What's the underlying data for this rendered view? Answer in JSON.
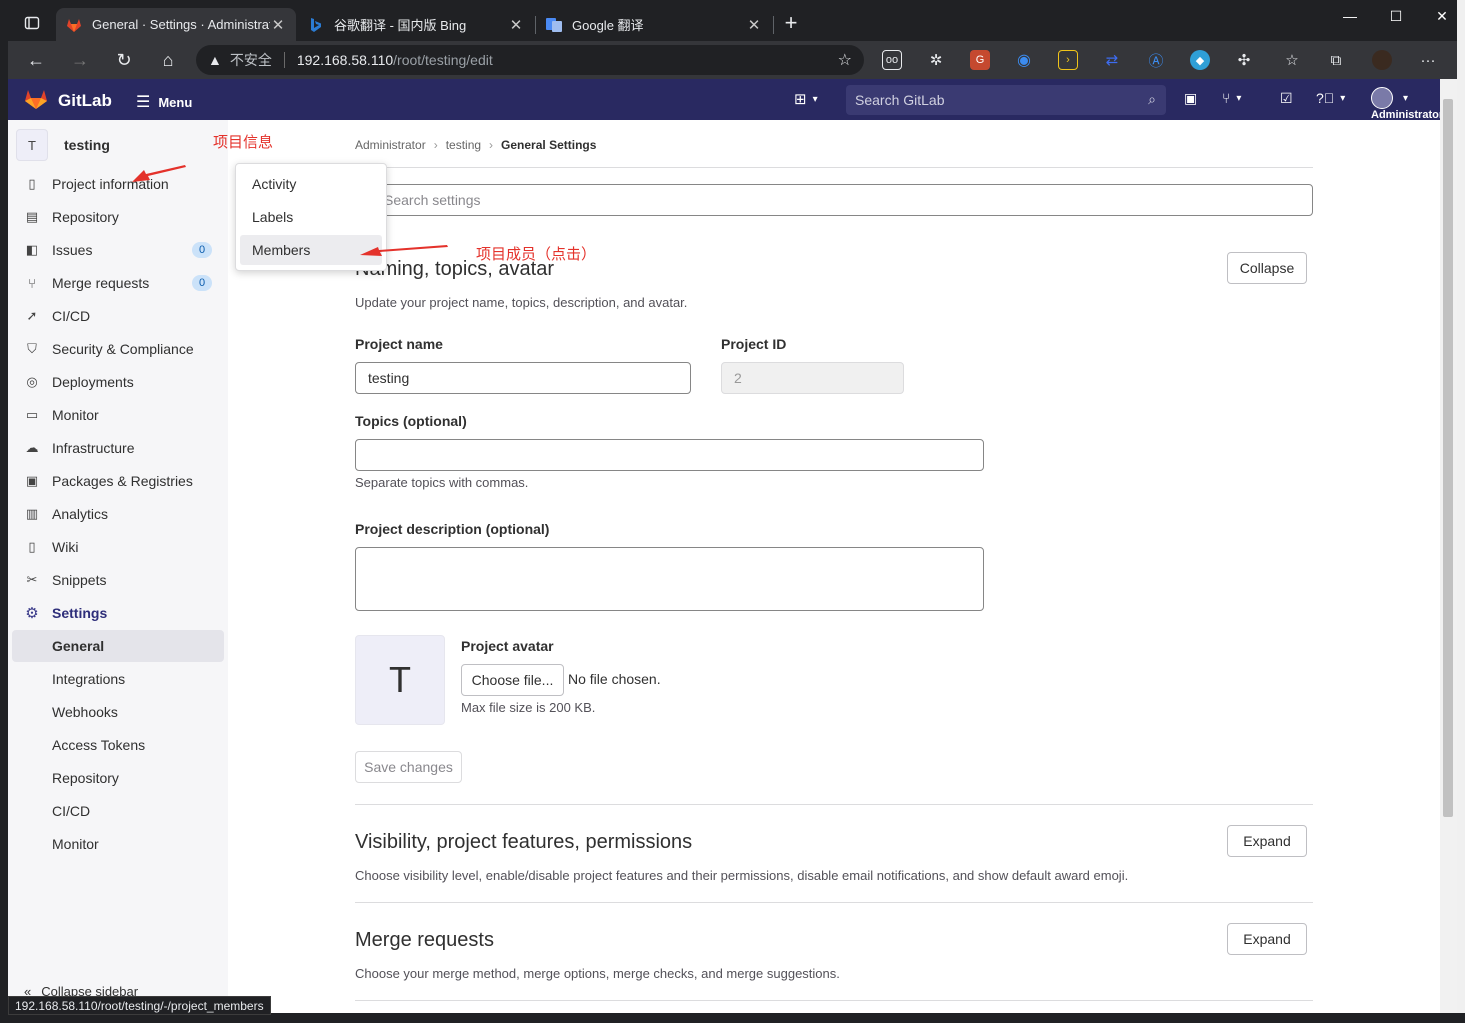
{
  "browser": {
    "tabs": [
      {
        "title": "General · Settings · Administrator",
        "active": true
      },
      {
        "title": "谷歌翻译 - 国内版 Bing",
        "active": false
      },
      {
        "title": "Google 翻译",
        "active": false
      }
    ],
    "new_tab": "+",
    "security_label": "不安全",
    "url_host": "192.168.58.110",
    "url_path": "/root/testing/edit",
    "status_url": "192.168.58.110/root/testing/-/project_members"
  },
  "gitlab_header": {
    "brand": "GitLab",
    "menu_label": "Menu",
    "search_placeholder": "Search GitLab",
    "user_label": "Administrator"
  },
  "sidebar": {
    "project_initial": "T",
    "project_name": "testing",
    "items": [
      {
        "label": "Project information",
        "icon": "info-icon"
      },
      {
        "label": "Repository",
        "icon": "doc-icon"
      },
      {
        "label": "Issues",
        "icon": "issues-icon",
        "badge": "0"
      },
      {
        "label": "Merge requests",
        "icon": "merge-icon",
        "badge": "0"
      },
      {
        "label": "CI/CD",
        "icon": "rocket-icon"
      },
      {
        "label": "Security & Compliance",
        "icon": "shield-icon"
      },
      {
        "label": "Deployments",
        "icon": "deploy-icon"
      },
      {
        "label": "Monitor",
        "icon": "monitor-icon"
      },
      {
        "label": "Infrastructure",
        "icon": "cloud-icon"
      },
      {
        "label": "Packages & Registries",
        "icon": "package-icon"
      },
      {
        "label": "Analytics",
        "icon": "chart-icon"
      },
      {
        "label": "Wiki",
        "icon": "book-icon"
      },
      {
        "label": "Snippets",
        "icon": "scissors-icon"
      },
      {
        "label": "Settings",
        "icon": "gear-icon"
      }
    ],
    "settings_sub": [
      "General",
      "Integrations",
      "Webhooks",
      "Access Tokens",
      "Repository",
      "CI/CD",
      "Monitor"
    ],
    "collapse_label": "Collapse sidebar"
  },
  "flyout": {
    "items": [
      "Activity",
      "Labels",
      "Members"
    ]
  },
  "annotations": {
    "project_info_note": "项目信息",
    "members_note": "项目成员（点击）"
  },
  "main": {
    "breadcrumb": [
      "Administrator",
      "testing",
      "General Settings"
    ],
    "search_placeholder": "Search settings",
    "naming": {
      "title": "Naming, topics, avatar",
      "desc": "Update your project name, topics, description, and avatar.",
      "collapse": "Collapse",
      "project_name_label": "Project name",
      "project_name_value": "testing",
      "project_id_label": "Project ID",
      "project_id_value": "2",
      "topics_label": "Topics (optional)",
      "topics_help": "Separate topics with commas.",
      "description_label": "Project description (optional)",
      "avatar_initial": "T",
      "avatar_label": "Project avatar",
      "choose_file": "Choose file...",
      "no_file": "No file chosen.",
      "max_size": "Max file size is 200 KB.",
      "save": "Save changes"
    },
    "visibility": {
      "title": "Visibility, project features, permissions",
      "desc": "Choose visibility level, enable/disable project features and their permissions, disable email notifications, and show default award emoji.",
      "expand": "Expand"
    },
    "merge": {
      "title": "Merge requests",
      "desc": "Choose your merge method, merge options, merge checks, and merge suggestions.",
      "expand": "Expand"
    }
  },
  "colors": {
    "gitlab_header": "#292961",
    "annotation_red": "#e4322b",
    "badge_bg": "#cbe2f9"
  }
}
